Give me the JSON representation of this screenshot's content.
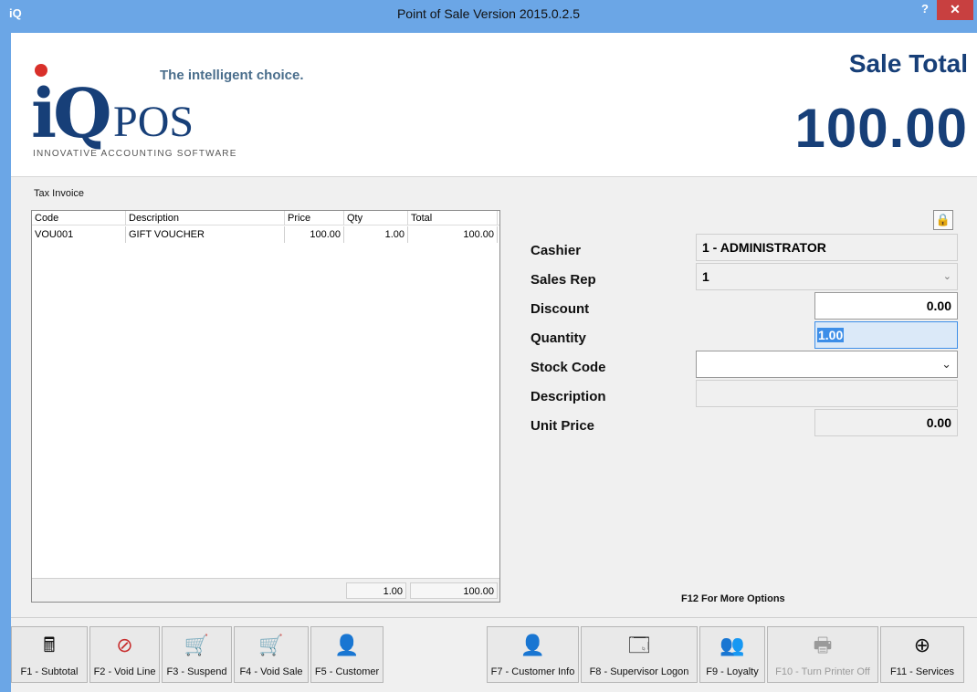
{
  "window": {
    "app_icon": "iQ",
    "title": "Point of Sale Version 2015.0.2.5",
    "help_label": "?",
    "close_label": "✕"
  },
  "logo": {
    "tagline": "The intelligent choice.",
    "brand_iq": "iQ",
    "brand_pos": "POS",
    "subline": "INNOVATIVE ACCOUNTING SOFTWARE"
  },
  "sale_total": {
    "label": "Sale Total",
    "value": "100.00"
  },
  "invoice": {
    "title": "Tax Invoice",
    "columns": [
      "Code",
      "Description",
      "Price",
      "Qty",
      "Total"
    ],
    "rows": [
      {
        "code": "VOU001",
        "description": "GIFT VOUCHER",
        "price": "100.00",
        "qty": "1.00",
        "total": "100.00"
      }
    ],
    "footer": {
      "qty": "1.00",
      "total": "100.00"
    }
  },
  "form": {
    "cashier": {
      "label": "Cashier",
      "value": "1 - ADMINISTRATOR"
    },
    "sales_rep": {
      "label": "Sales Rep",
      "value": "1"
    },
    "discount": {
      "label": "Discount",
      "value": "0.00"
    },
    "quantity": {
      "label": "Quantity",
      "value": "1.00"
    },
    "stock_code": {
      "label": "Stock Code",
      "value": ""
    },
    "description": {
      "label": "Description",
      "value": ""
    },
    "unit_price": {
      "label": "Unit Price",
      "value": "0.00"
    }
  },
  "more_options": "F12 For More Options",
  "toolbar": {
    "f1": "F1 - Subtotal",
    "f2": "F2 - Void Line",
    "f3": "F3 - Suspend",
    "f4": "F4 - Void Sale",
    "f5": "F5 - Customer",
    "f7": "F7 - Customer Info",
    "f8": "F8 - Supervisor Logon",
    "f9": "F9 - Loyalty",
    "f10": "F10 - Turn Printer Off",
    "f11": "F11 - Services"
  }
}
